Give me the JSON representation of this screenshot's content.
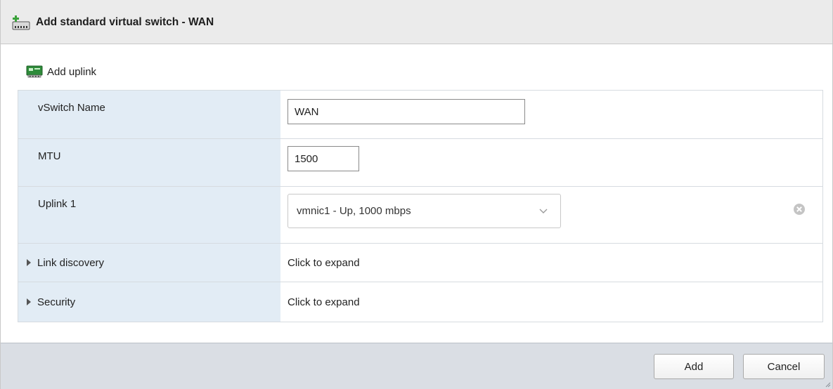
{
  "dialog": {
    "title": "Add standard virtual switch - WAN"
  },
  "toolbar": {
    "add_uplink_label": "Add uplink"
  },
  "form": {
    "vswitch_name": {
      "label": "vSwitch Name",
      "value": "WAN"
    },
    "mtu": {
      "label": "MTU",
      "value": "1500"
    },
    "uplink1": {
      "label": "Uplink 1",
      "selected": "vmnic1 - Up, 1000 mbps"
    },
    "link_discovery": {
      "label": "Link discovery",
      "value": "Click to expand"
    },
    "security": {
      "label": "Security",
      "value": "Click to expand"
    }
  },
  "footer": {
    "add_label": "Add",
    "cancel_label": "Cancel"
  },
  "icons": {
    "title": "add-vswitch-icon",
    "add_uplink": "add-uplink-icon",
    "select_arrow": "chevron-down-icon",
    "remove_uplink": "remove-circle-icon",
    "expand": "caret-right-icon"
  }
}
